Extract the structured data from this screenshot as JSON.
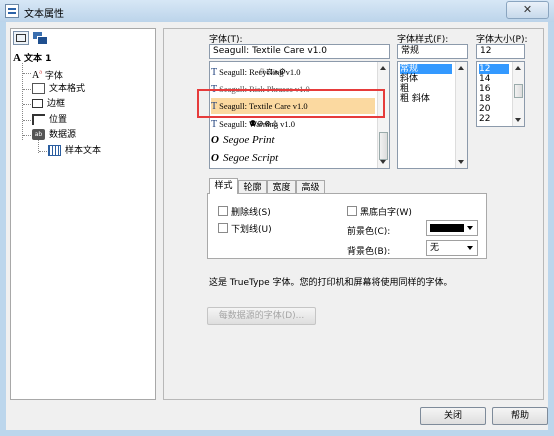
{
  "window": {
    "title": "文本属性",
    "close_glyph": "✕"
  },
  "tree": {
    "items": [
      {
        "label": "文本 1",
        "icon": "text-object-icon"
      },
      {
        "label": "字体",
        "icon": "font-icon"
      },
      {
        "label": "文本格式",
        "icon": "text-format-icon"
      },
      {
        "label": "边框",
        "icon": "border-icon"
      },
      {
        "label": "位置",
        "icon": "position-icon"
      },
      {
        "label": "数据源",
        "icon": "data-source-icon"
      },
      {
        "label": "样本文本",
        "icon": "sample-text-icon"
      }
    ]
  },
  "font": {
    "label": "字体(T):",
    "value": "Seagull: Textile Care v1.0",
    "list": [
      {
        "name": "Seagull: Recycling v1.0",
        "symbols": "♲⚖ѧ⚙",
        "type": "tt"
      },
      {
        "name": "Seagull: Risk Phrases v1.0",
        "symbols": "",
        "type": "tt"
      },
      {
        "name": "Seagull: Textile Care v1.0",
        "symbols": "",
        "type": "tt"
      },
      {
        "name": "Seagull: Warning v1.0",
        "symbols": "⚉⊘⊗⚠",
        "type": "tt"
      },
      {
        "name": "Segoe Print",
        "symbols": "",
        "type": "o"
      },
      {
        "name": "Segoe Script",
        "symbols": "",
        "type": "o"
      }
    ],
    "type_glyph_tt": "T",
    "type_glyph_o": "O"
  },
  "style": {
    "label": "字体样式(F):",
    "value": "常规",
    "options": [
      "常规",
      "斜体",
      "粗",
      "粗 斜体"
    ]
  },
  "size": {
    "label": "字体大小(P):",
    "value": "12",
    "options": [
      "12",
      "14",
      "16",
      "18",
      "20",
      "22"
    ]
  },
  "tabs": [
    "样式",
    "轮廓",
    "宽度",
    "高级"
  ],
  "effects": {
    "strikethrough": "删除线(S)",
    "underline": "下划线(U)",
    "white_on_black": "黑底白字(W)",
    "foreground_label": "前景色(C):",
    "background_label": "背景色(B):",
    "foreground_color": "#000000",
    "background_value": "无"
  },
  "info_text": "这是 TrueType 字体。您的打印机和屏幕将使用同样的字体。",
  "datasource_font_button": "每数据源的字体(D)...",
  "buttons": {
    "close": "关闭",
    "help": "帮助"
  }
}
